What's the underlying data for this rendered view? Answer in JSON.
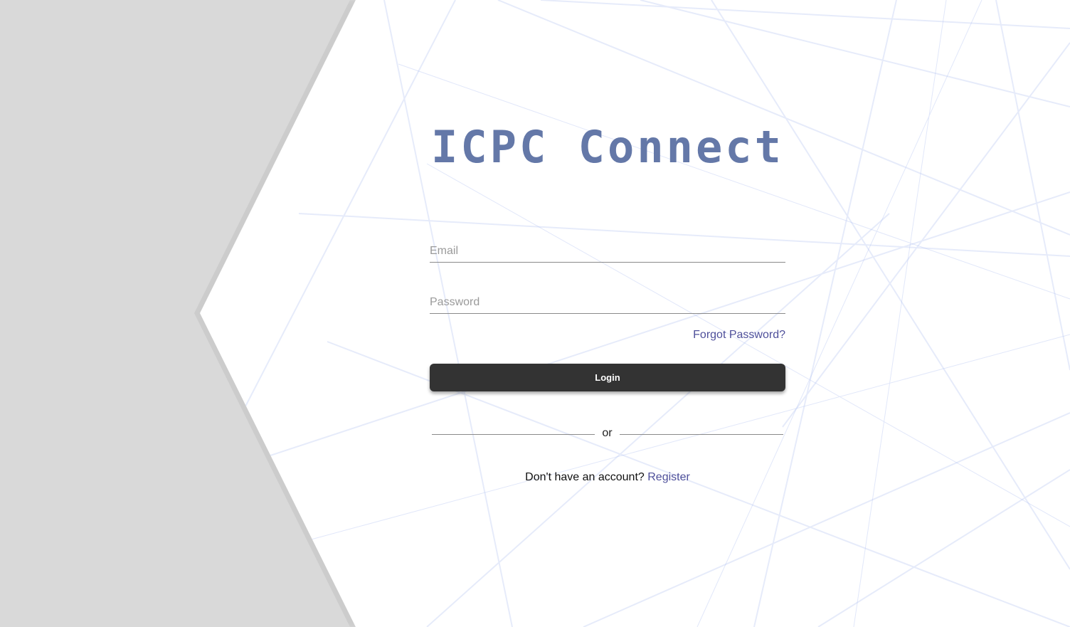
{
  "brand": {
    "title": "ICPC Connect",
    "color": "#6478a8"
  },
  "form": {
    "email_placeholder": "Email",
    "password_placeholder": "Password",
    "forgot_password_label": "Forgot Password?",
    "login_label": "Login",
    "divider_text": "or",
    "register_prompt": "Don't have an account?",
    "register_label": "Register"
  },
  "colors": {
    "background_left": "#d9d9d9",
    "background_right": "#ffffff",
    "button": "#333333",
    "link": "#4e4f9a"
  }
}
